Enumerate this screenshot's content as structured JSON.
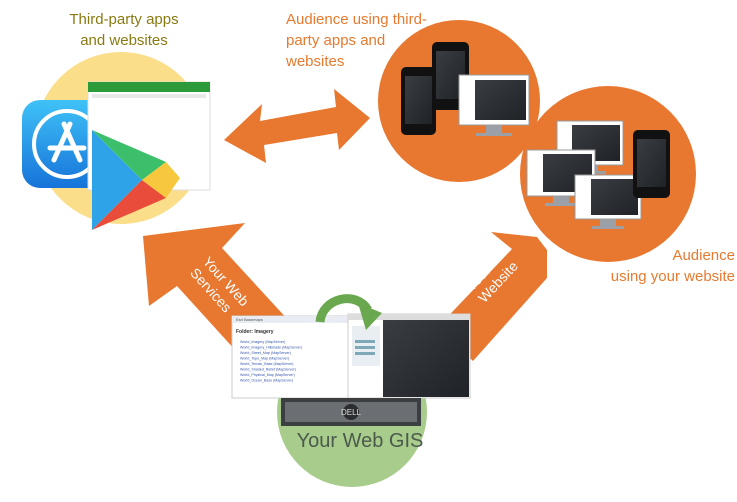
{
  "labels": {
    "third_party_apps": "Third-party apps\nand websites",
    "audience_third_party": "Audience using third-\nparty apps and\nwebsites",
    "audience_website": "Audience\nusing your website",
    "your_web_gis": "Your Web GIS",
    "arrow_web_services": "Your Web\nServices",
    "arrow_website": "Your\nWebsite"
  },
  "screens": {
    "service_title": "Esri Basemaps",
    "service_heading": "Folder: Imagery",
    "service_links": [
      "World_Imagery (MapServer)",
      "World_Imagery_Hillshade (MapServer)",
      "World_Street_Map (MapServer)",
      "World_Topo_Map (MapServer)",
      "World_Terrain_Base (MapServer)",
      "World_Shaded_Relief (MapServer)",
      "World_Physical_Map (MapServer)",
      "World_Ocean_Base (MapServer)"
    ]
  },
  "colors": {
    "orange": "#e8772f",
    "light_yellow": "#fbde8a",
    "light_green": "#a8cc8c",
    "olive_text": "#8a7a12",
    "orange_text": "#e67a2e",
    "green_arrow": "#6aa84f"
  },
  "icons": [
    "app-store-icon",
    "play-store-icon",
    "refresh-arrow-icon",
    "server-icon"
  ]
}
